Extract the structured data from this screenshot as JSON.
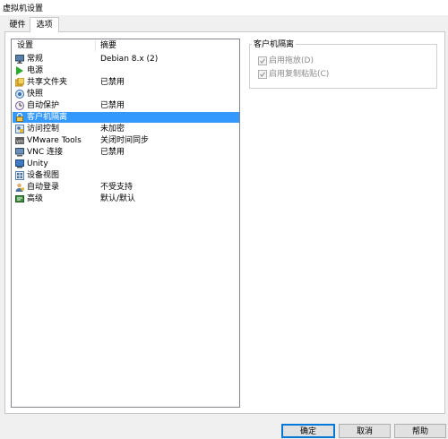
{
  "window": {
    "title": "虚拟机设置"
  },
  "tabs": [
    {
      "label": "硬件",
      "active": false
    },
    {
      "label": "选项",
      "active": true
    }
  ],
  "list": {
    "headers": {
      "setting": "设置",
      "summary": "摘要"
    },
    "items": [
      {
        "label": "常规",
        "summary": "Debian 8.x (2)",
        "icon": "monitor-icon",
        "selected": false
      },
      {
        "label": "电源",
        "summary": "",
        "icon": "play-icon",
        "selected": false
      },
      {
        "label": "共享文件夹",
        "summary": "已禁用",
        "icon": "shared-folder-icon",
        "selected": false
      },
      {
        "label": "快照",
        "summary": "",
        "icon": "snapshot-icon",
        "selected": false
      },
      {
        "label": "自动保护",
        "summary": "已禁用",
        "icon": "clock-icon",
        "selected": false
      },
      {
        "label": "客户机隔离",
        "summary": "",
        "icon": "lock-icon",
        "selected": true
      },
      {
        "label": "访问控制",
        "summary": "未加密",
        "icon": "access-control-icon",
        "selected": false
      },
      {
        "label": "VMware Tools",
        "summary": "关闭时间同步",
        "icon": "vmware-tools-icon",
        "selected": false
      },
      {
        "label": "VNC 连接",
        "summary": "已禁用",
        "icon": "vnc-icon",
        "selected": false
      },
      {
        "label": "Unity",
        "summary": "",
        "icon": "unity-icon",
        "selected": false
      },
      {
        "label": "设备视图",
        "summary": "",
        "icon": "device-view-icon",
        "selected": false
      },
      {
        "label": "自动登录",
        "summary": "不受支持",
        "icon": "user-icon",
        "selected": false
      },
      {
        "label": "高级",
        "summary": "默认/默认",
        "icon": "advanced-icon",
        "selected": false
      }
    ]
  },
  "isolation": {
    "title": "客户机隔离",
    "options": [
      {
        "label": "启用拖放(D)",
        "checked": true,
        "enabled": false
      },
      {
        "label": "启用复制粘贴(C)",
        "checked": true,
        "enabled": false
      }
    ]
  },
  "buttons": {
    "ok": "确定",
    "cancel": "取消",
    "help": "帮助"
  },
  "colors": {
    "selection": "#3399ff",
    "ok_border": "#0078d7",
    "disabled_text": "#8c8c8c"
  }
}
